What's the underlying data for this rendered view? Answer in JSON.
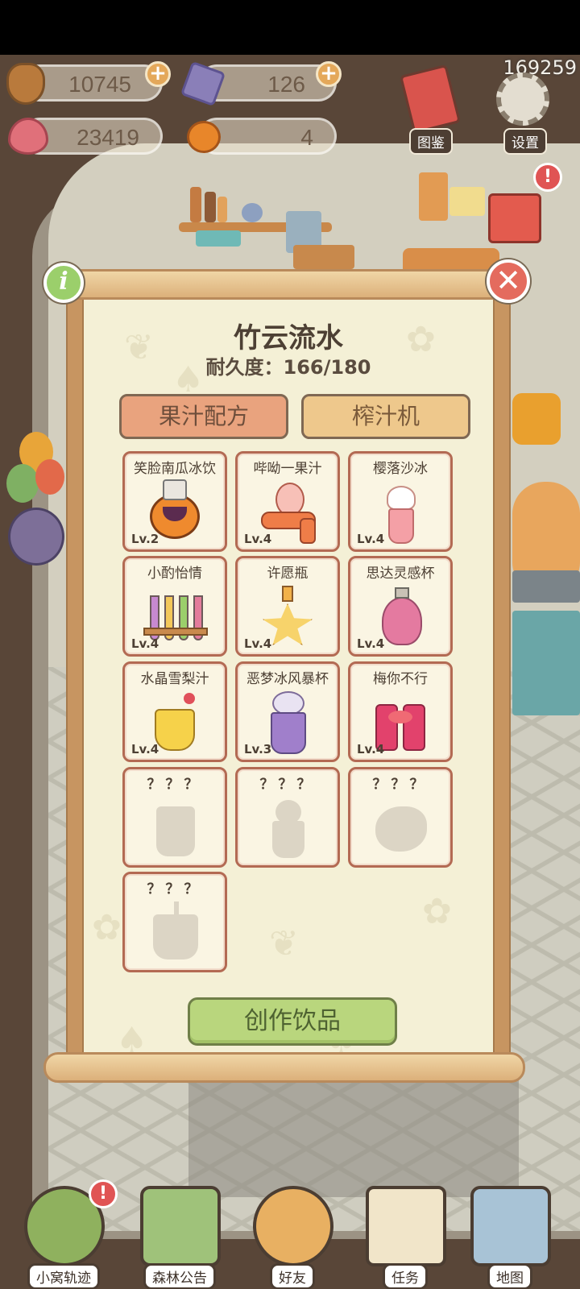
{
  "resources": {
    "acorn": "10745",
    "crystal": "126",
    "heart": "23419",
    "pumpkin": "4",
    "counter": "169259"
  },
  "top_buttons": {
    "guide_label": "图鉴",
    "settings_label": "设置"
  },
  "notifications": {
    "badge": "!"
  },
  "panel": {
    "title": "竹云流水",
    "durability": "耐久度：166/180",
    "info_label": "i",
    "close_label": "✕",
    "tabs": [
      "果汁配方",
      "榨汁机"
    ],
    "recipes": [
      {
        "name": "笑脸南瓜冰饮",
        "level": "Lv.2"
      },
      {
        "name": "哔呦一果汁",
        "level": "Lv.4"
      },
      {
        "name": "樱落沙冰",
        "level": "Lv.4"
      },
      {
        "name": "小酌怡情",
        "level": "Lv.4"
      },
      {
        "name": "许愿瓶",
        "level": "Lv.4"
      },
      {
        "name": "思达灵感杯",
        "level": "Lv.4"
      },
      {
        "name": "水晶雪梨汁",
        "level": "Lv.4"
      },
      {
        "name": "恶梦冰风暴杯",
        "level": "Lv.3"
      },
      {
        "name": "梅你不行",
        "level": "Lv.4"
      },
      {
        "name": "？？？",
        "level": ""
      },
      {
        "name": "？？？",
        "level": ""
      },
      {
        "name": "？？？",
        "level": ""
      },
      {
        "name": "？？？",
        "level": ""
      }
    ],
    "create_label": "创作饮品"
  },
  "bottom_nav": [
    "小窝轨迹",
    "森林公告",
    "好友",
    "任务",
    "地图"
  ],
  "colors": {
    "card_border": "#b36a53",
    "tab_active": "#e9a37e",
    "tab_inactive": "#eec88c",
    "create_button": "#b9d67d",
    "paper": "#f4f0d6"
  }
}
